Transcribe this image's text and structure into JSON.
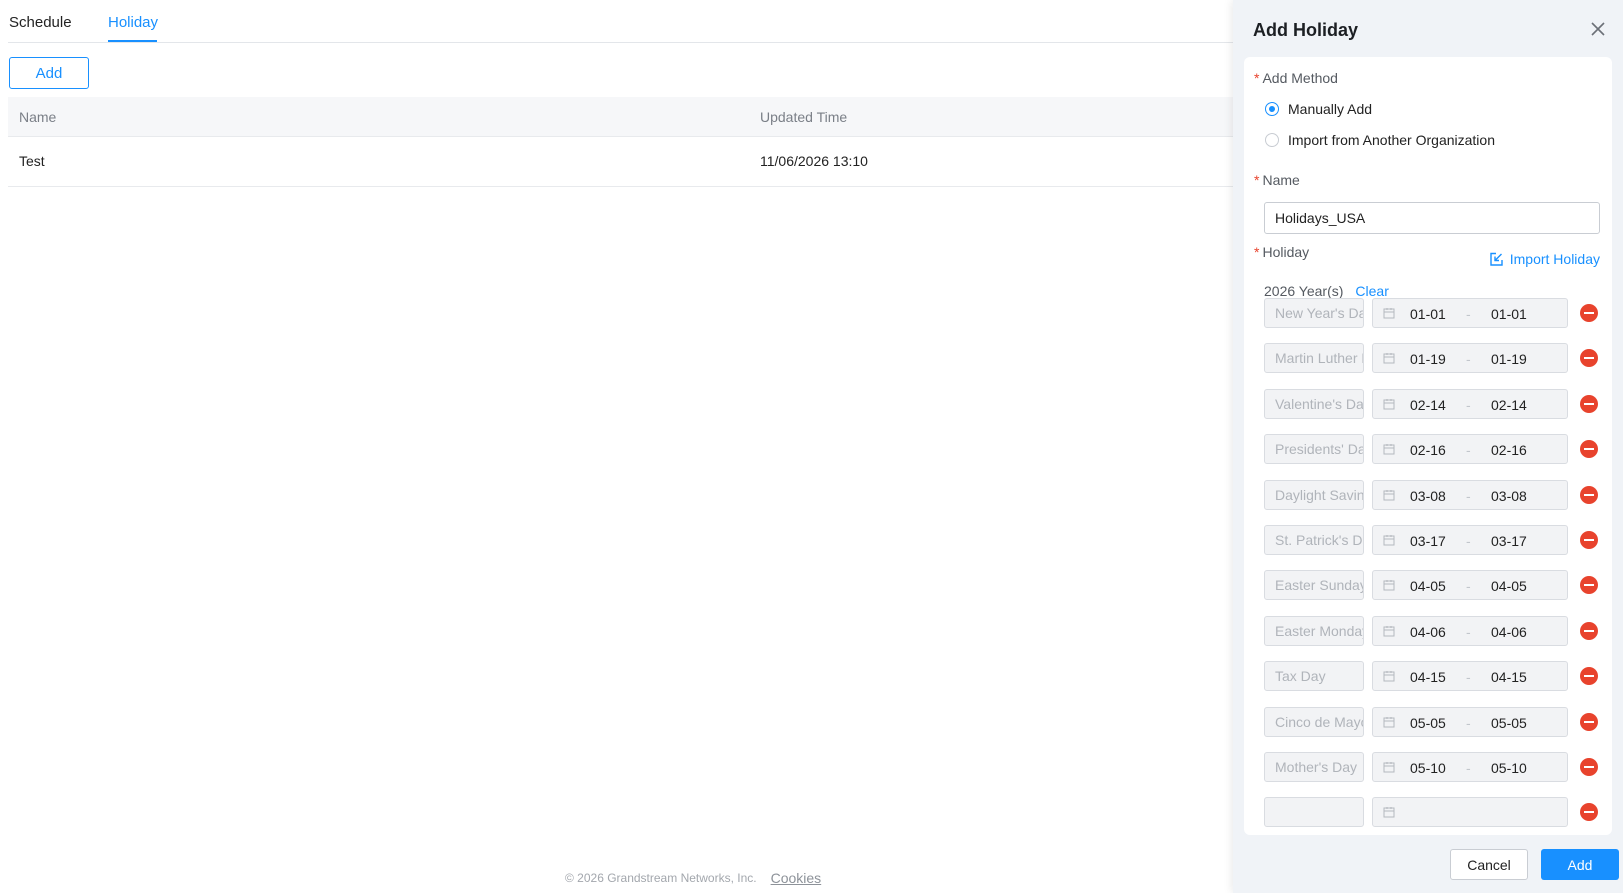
{
  "tabs": [
    {
      "label": "Schedule",
      "active": false
    },
    {
      "label": "Holiday",
      "active": true
    }
  ],
  "toolbar": {
    "add_label": "Add"
  },
  "table": {
    "columns": [
      "Name",
      "Updated Time"
    ],
    "rows": [
      {
        "name": "Test",
        "updated": "11/06/2026 13:10"
      }
    ]
  },
  "footer": {
    "copyright": "© 2026 Grandstream Networks, Inc.",
    "cookies": "Cookies"
  },
  "drawer": {
    "title": "Add Holiday",
    "add_method_label": "Add Method",
    "methods": [
      {
        "label": "Manually Add",
        "selected": true
      },
      {
        "label": "Import from Another Organization",
        "selected": false
      }
    ],
    "name_label": "Name",
    "name_value": "Holidays_USA",
    "holiday_label": "Holiday",
    "import_holiday": "Import Holiday",
    "year_text": "2026 Year(s)",
    "clear": "Clear",
    "holidays": [
      {
        "name": "New Year's Day",
        "start": "01-01",
        "end": "01-01"
      },
      {
        "name": "Martin Luther King Jr. Day",
        "start": "01-19",
        "end": "01-19"
      },
      {
        "name": "Valentine's Day",
        "start": "02-14",
        "end": "02-14"
      },
      {
        "name": "Presidents' Day",
        "start": "02-16",
        "end": "02-16"
      },
      {
        "name": "Daylight Saving Time starts",
        "start": "03-08",
        "end": "03-08"
      },
      {
        "name": "St. Patrick's Day",
        "start": "03-17",
        "end": "03-17"
      },
      {
        "name": "Easter Sunday",
        "start": "04-05",
        "end": "04-05"
      },
      {
        "name": "Easter Monday",
        "start": "04-06",
        "end": "04-06"
      },
      {
        "name": "Tax Day",
        "start": "04-15",
        "end": "04-15"
      },
      {
        "name": "Cinco de Mayo",
        "start": "05-05",
        "end": "05-05"
      },
      {
        "name": "Mother's Day",
        "start": "05-10",
        "end": "05-10"
      }
    ],
    "cancel_label": "Cancel",
    "add_label": "Add"
  },
  "colors": {
    "accent": "#1890ff",
    "danger": "#e8432d"
  }
}
